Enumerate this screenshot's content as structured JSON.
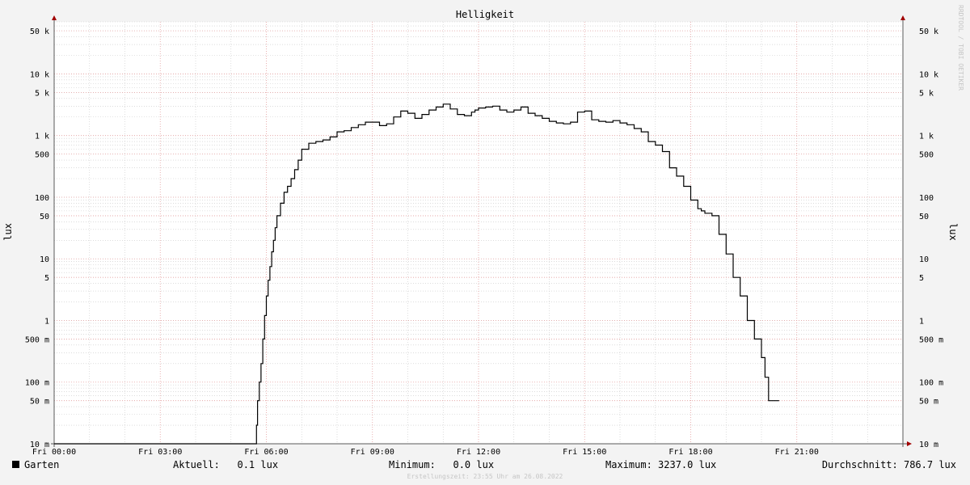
{
  "chart_data": {
    "type": "line",
    "title": "Helligkeit",
    "ylabel": "lux",
    "yscale": "log",
    "ylim": [
      0.01,
      70000
    ],
    "y_ticks": [
      {
        "value": 0.01,
        "label": "10 m"
      },
      {
        "value": 0.05,
        "label": "50 m"
      },
      {
        "value": 0.1,
        "label": "100 m"
      },
      {
        "value": 0.5,
        "label": "500 m"
      },
      {
        "value": 1,
        "label": "1"
      },
      {
        "value": 5,
        "label": "5"
      },
      {
        "value": 10,
        "label": "10"
      },
      {
        "value": 50,
        "label": "50"
      },
      {
        "value": 100,
        "label": "100"
      },
      {
        "value": 500,
        "label": "500"
      },
      {
        "value": 1000,
        "label": "1 k"
      },
      {
        "value": 5000,
        "label": "5 k"
      },
      {
        "value": 10000,
        "label": "10 k"
      },
      {
        "value": 50000,
        "label": "50 k"
      }
    ],
    "x_ticks": [
      {
        "hour": 0,
        "label": "Fri 00:00"
      },
      {
        "hour": 3,
        "label": "Fri 03:00"
      },
      {
        "hour": 6,
        "label": "Fri 06:00"
      },
      {
        "hour": 9,
        "label": "Fri 09:00"
      },
      {
        "hour": 12,
        "label": "Fri 12:00"
      },
      {
        "hour": 15,
        "label": "Fri 15:00"
      },
      {
        "hour": 18,
        "label": "Fri 18:00"
      },
      {
        "hour": 21,
        "label": "Fri 21:00"
      }
    ],
    "xlim_hours": [
      0,
      24
    ],
    "grid": true,
    "series": [
      {
        "name": "Garten",
        "color": "#000000",
        "x_hours": [
          0,
          5.7,
          5.72,
          5.75,
          5.8,
          5.85,
          5.9,
          5.95,
          6.0,
          6.05,
          6.1,
          6.15,
          6.2,
          6.25,
          6.3,
          6.4,
          6.5,
          6.6,
          6.7,
          6.8,
          6.9,
          7.0,
          7.2,
          7.4,
          7.6,
          7.8,
          8.0,
          8.2,
          8.4,
          8.6,
          8.8,
          9.0,
          9.2,
          9.4,
          9.6,
          9.8,
          10.0,
          10.2,
          10.4,
          10.6,
          10.8,
          11.0,
          11.2,
          11.4,
          11.6,
          11.8,
          11.9,
          12.0,
          12.2,
          12.4,
          12.6,
          12.8,
          13.0,
          13.2,
          13.4,
          13.6,
          13.8,
          14.0,
          14.2,
          14.4,
          14.6,
          14.8,
          15.0,
          15.2,
          15.4,
          15.6,
          15.8,
          16.0,
          16.2,
          16.4,
          16.6,
          16.8,
          17.0,
          17.2,
          17.4,
          17.6,
          17.8,
          18.0,
          18.2,
          18.3,
          18.4,
          18.6,
          18.8,
          19.0,
          19.2,
          19.4,
          19.6,
          19.8,
          20.0,
          20.1,
          20.2,
          20.3,
          20.4,
          20.5,
          20.6,
          20.7,
          20.8,
          20.9,
          21.0,
          21.1,
          21.2,
          22.0,
          24.0
        ],
        "values": [
          0.01,
          0.01,
          0.02,
          0.05,
          0.1,
          0.2,
          0.5,
          1.2,
          2.5,
          4.5,
          7.5,
          13,
          20,
          32,
          50,
          80,
          120,
          150,
          200,
          280,
          400,
          600,
          750,
          800,
          850,
          950,
          1150,
          1200,
          1350,
          1500,
          1650,
          1650,
          1450,
          1550,
          2000,
          2500,
          2300,
          1900,
          2200,
          2600,
          2900,
          3237,
          2700,
          2200,
          2100,
          2400,
          2600,
          2800,
          2900,
          3000,
          2600,
          2400,
          2600,
          2900,
          2300,
          2100,
          1900,
          1700,
          1600,
          1550,
          1650,
          2400,
          2500,
          1800,
          1700,
          1650,
          1750,
          1600,
          1500,
          1300,
          1150,
          800,
          700,
          550,
          300,
          220,
          150,
          90,
          65,
          60,
          55,
          50,
          25,
          12,
          5,
          2.5,
          1.0,
          0.5,
          0.25,
          0.12,
          0.05,
          0.05,
          0.05
        ]
      }
    ]
  },
  "legend": {
    "series_name": "Garten",
    "current": "Aktuell:   0.1 lux",
    "minimum": "Minimum:   0.0 lux",
    "maximum": "Maximum: 3237.0 lux",
    "average": "Durchschnitt: 786.7 lux"
  },
  "footer": "Erstellungszeit: 23:55 Uhr am 26.08.2022",
  "watermark": "RRDTOOL / TOBI OETIKER",
  "colors": {
    "background": "#f3f3f3",
    "plot_bg": "#ffffff",
    "major_grid": "#e5a0a0",
    "minor_grid": "#c8c8c8",
    "axis": "#5a5a5a",
    "arrow": "#a00000",
    "line": "#000000"
  }
}
